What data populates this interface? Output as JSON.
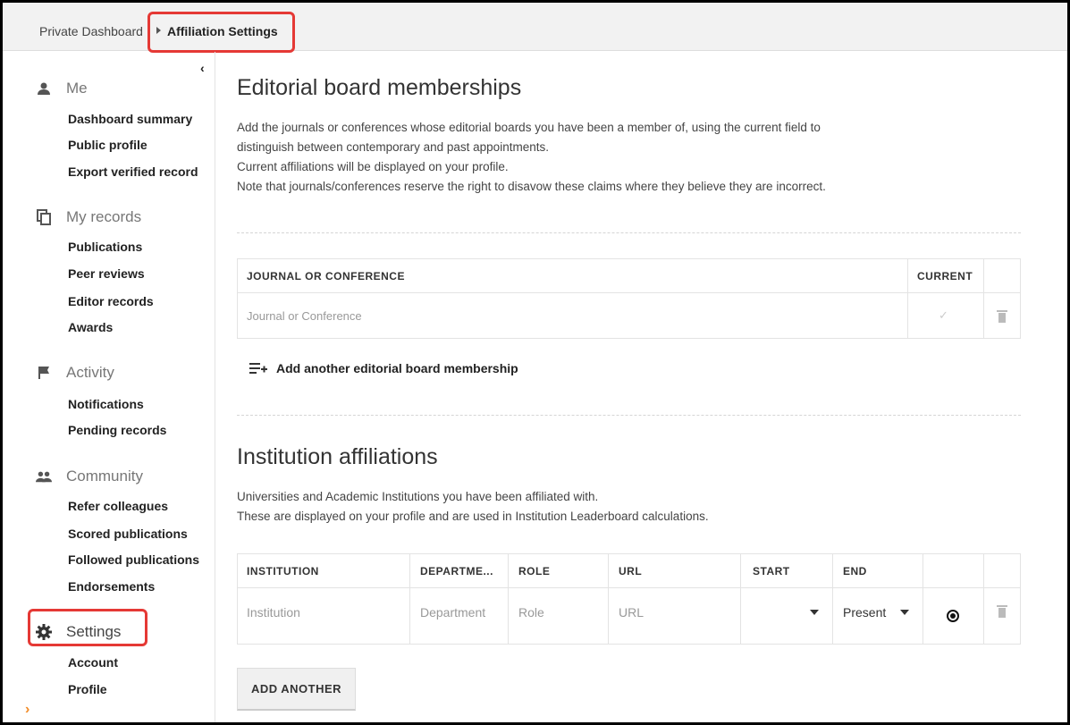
{
  "breadcrumb": {
    "home": "Private Dashboard",
    "current": "Affiliation Settings"
  },
  "sidebar": {
    "collapse_glyph": "‹",
    "expand_glyph": "›",
    "sections": [
      {
        "label": "Me",
        "icon": "person-icon",
        "items": [
          "Dashboard summary",
          "Public profile",
          "Export verified record"
        ]
      },
      {
        "label": "My records",
        "icon": "copy-icon",
        "items": [
          "Publications",
          "Peer reviews",
          "Editor records",
          "Awards"
        ]
      },
      {
        "label": "Activity",
        "icon": "flag-icon",
        "items": [
          "Notifications",
          "Pending records"
        ]
      },
      {
        "label": "Community",
        "icon": "people-icon",
        "items": [
          "Refer colleagues",
          "Scored publications",
          "Followed publications",
          "Endorsements"
        ]
      },
      {
        "label": "Settings",
        "icon": "gear-icon",
        "items": [
          "Account",
          "Profile"
        ]
      }
    ]
  },
  "editorial": {
    "title": "Editorial board memberships",
    "desc_lines": [
      "Add the journals or conferences whose editorial boards you have been a member of, using the current field to",
      "distinguish between contemporary and past appointments.",
      "Current affiliations will be displayed on your profile.",
      "Note that journals/conferences reserve the right to disavow these claims where they believe they are incorrect."
    ],
    "headers": [
      "JOURNAL OR CONFERENCE",
      "CURRENT"
    ],
    "row_placeholder": "Journal or Conference",
    "add_label": "Add another editorial board membership"
  },
  "institution": {
    "title": "Institution affiliations",
    "desc_lines": [
      "Universities and Academic Institutions you have been affiliated with.",
      "These are displayed on your profile and are used in Institution Leaderboard calculations."
    ],
    "headers": [
      "INSTITUTION",
      "DEPARTME...",
      "ROLE",
      "URL",
      "START",
      "END"
    ],
    "row": {
      "institution": "Institution",
      "department": "Department",
      "role": "Role",
      "url": "URL",
      "start": "",
      "end": "Present"
    },
    "add_button": "ADD ANOTHER"
  },
  "colors": {
    "highlight": "#e53935",
    "accent": "#f28c28"
  }
}
